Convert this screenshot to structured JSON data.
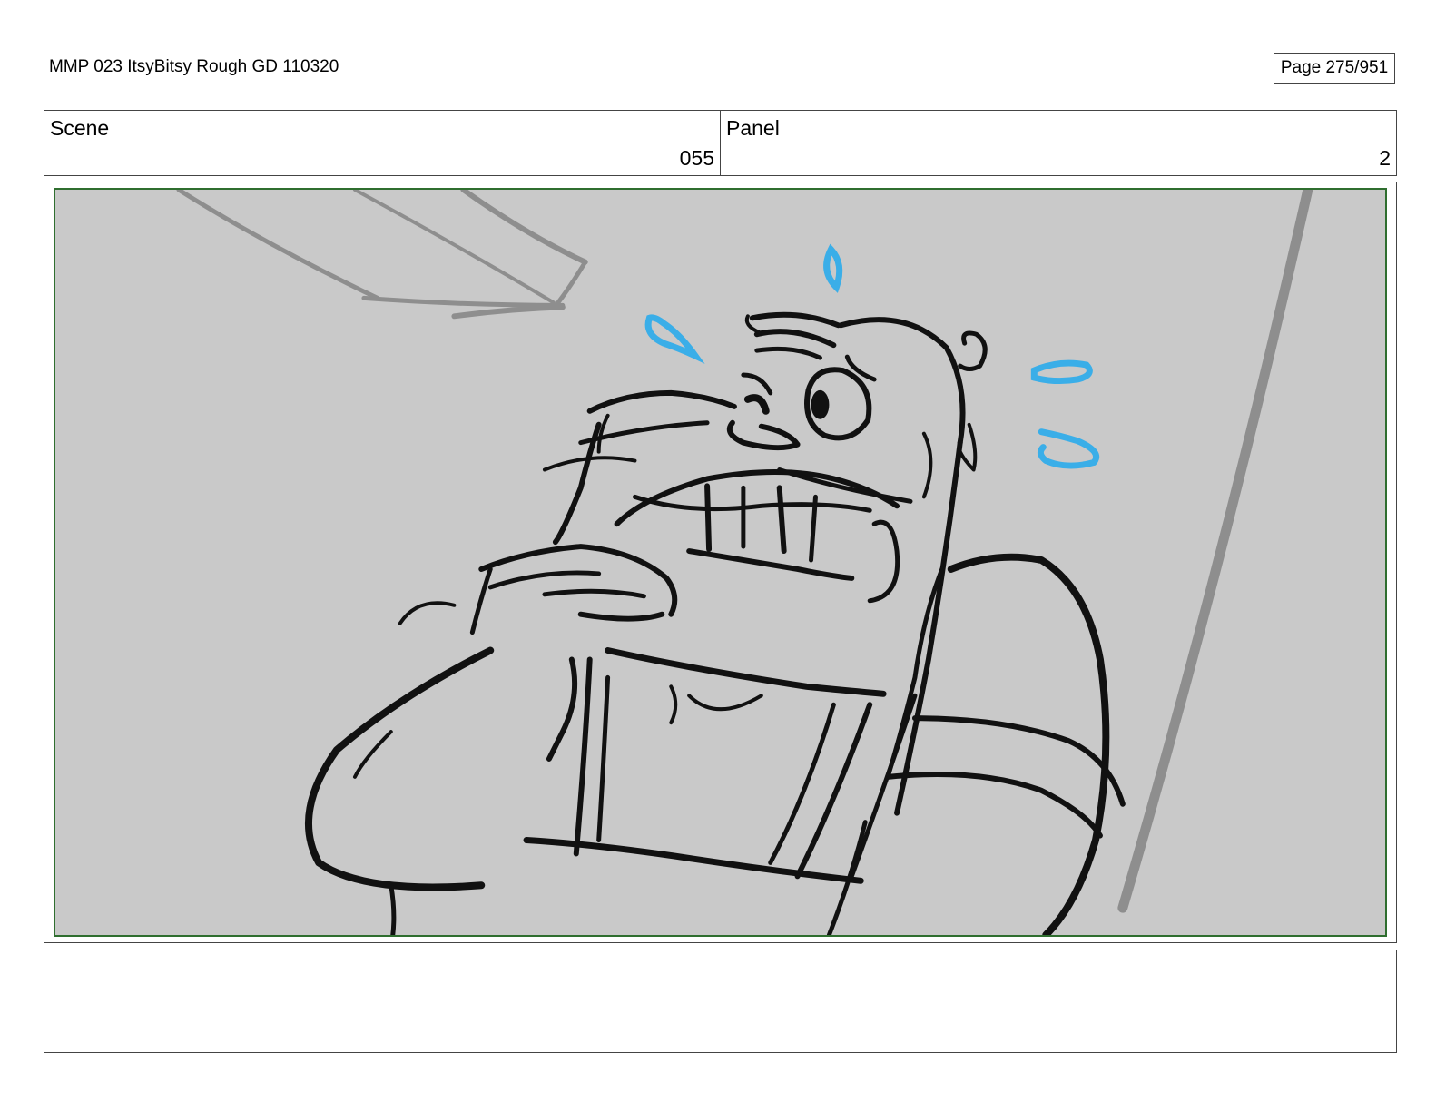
{
  "header": {
    "title": "MMP 023 ItsyBitsy Rough GD 110320",
    "page": "Page 275/951"
  },
  "info": {
    "scene_label": "Scene",
    "scene_value": "055",
    "panel_label": "Panel",
    "panel_value": "2"
  },
  "notes": {
    "text": ""
  },
  "colors": {
    "sketch_line": "#111111",
    "sweat_drops": "#3aaee8",
    "background_lines": "#8e8e8e",
    "panel_border": "#2f6e2f",
    "panel_fill": "#c9c9c9"
  }
}
